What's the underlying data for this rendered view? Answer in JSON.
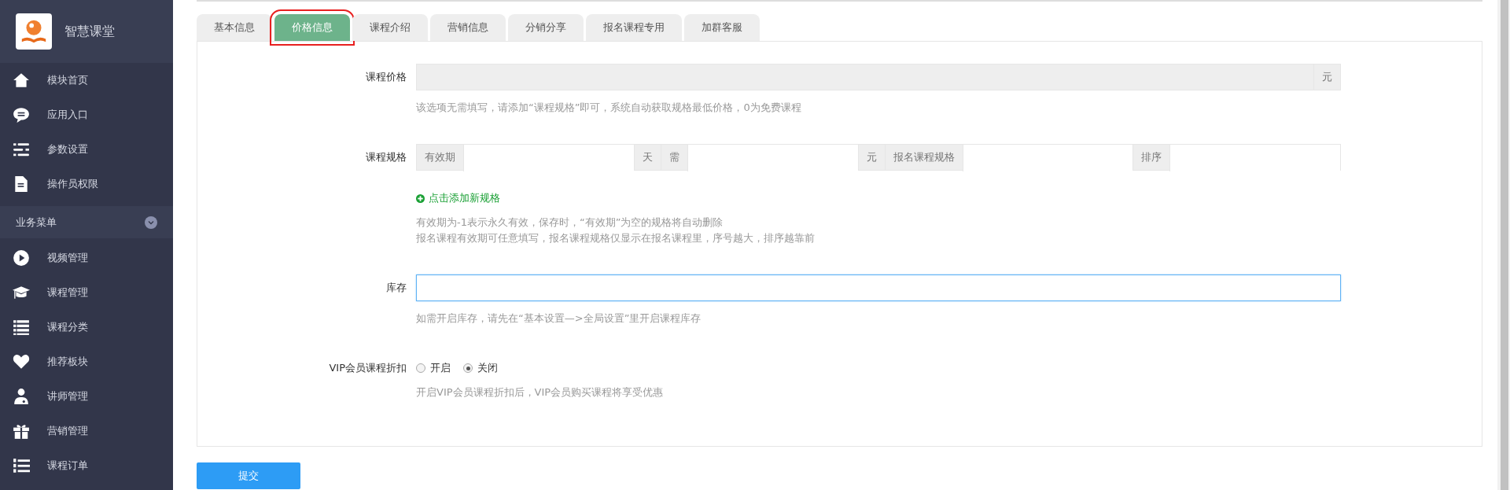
{
  "sidebar": {
    "brand": "智慧课堂",
    "top_items": [
      {
        "label": "模块首页"
      },
      {
        "label": "应用入口"
      },
      {
        "label": "参数设置"
      },
      {
        "label": "操作员权限"
      }
    ],
    "section": {
      "label": "业务菜单",
      "expanded": true
    },
    "items": [
      {
        "label": "视频管理"
      },
      {
        "label": "课程管理"
      },
      {
        "label": "课程分类"
      },
      {
        "label": "推荐板块"
      },
      {
        "label": "讲师管理"
      },
      {
        "label": "营销管理"
      },
      {
        "label": "课程订单"
      }
    ]
  },
  "tabs": [
    {
      "label": "基本信息",
      "selected": false
    },
    {
      "label": "价格信息",
      "selected": true
    },
    {
      "label": "课程介绍",
      "selected": false
    },
    {
      "label": "营销信息",
      "selected": false
    },
    {
      "label": "分销分享",
      "selected": false
    },
    {
      "label": "报名课程专用",
      "selected": false
    },
    {
      "label": "加群客服",
      "selected": false
    }
  ],
  "form": {
    "price": {
      "label": "课程价格",
      "unit": "元",
      "disabled": true,
      "hint": "该选项无需填写，请添加“课程规格”即可，系统自动获取规格最低价格，0为免费课程"
    },
    "spec": {
      "label": "课程规格",
      "parts": [
        {
          "kind": "addon",
          "text": "有效期"
        },
        {
          "kind": "input"
        },
        {
          "kind": "addon",
          "text": "天"
        },
        {
          "kind": "addon",
          "text": "需"
        },
        {
          "kind": "input"
        },
        {
          "kind": "addon",
          "text": "元"
        },
        {
          "kind": "addon",
          "text": "报名课程规格"
        },
        {
          "kind": "input"
        },
        {
          "kind": "addon",
          "text": "排序"
        },
        {
          "kind": "input"
        }
      ],
      "add_link": "点击添加新规格",
      "hints": [
        "有效期为-1表示永久有效，保存时，“有效期”为空的规格将自动删除",
        "报名课程有效期可任意填写，报名课程规格仅显示在报名课程里，序号越大，排序越靠前"
      ]
    },
    "stock": {
      "label": "库存",
      "focused": true,
      "hint": "如需开启库存，请先在“基本设置—>全局设置”里开启课程库存"
    },
    "vip": {
      "label": "VIP会员课程折扣",
      "options": [
        {
          "label": "开启",
          "selected": false
        },
        {
          "label": "关闭",
          "selected": true
        }
      ],
      "hint": "开启VIP会员课程折扣后，VIP会员购买课程将享受优惠"
    }
  },
  "submit": "提交"
}
